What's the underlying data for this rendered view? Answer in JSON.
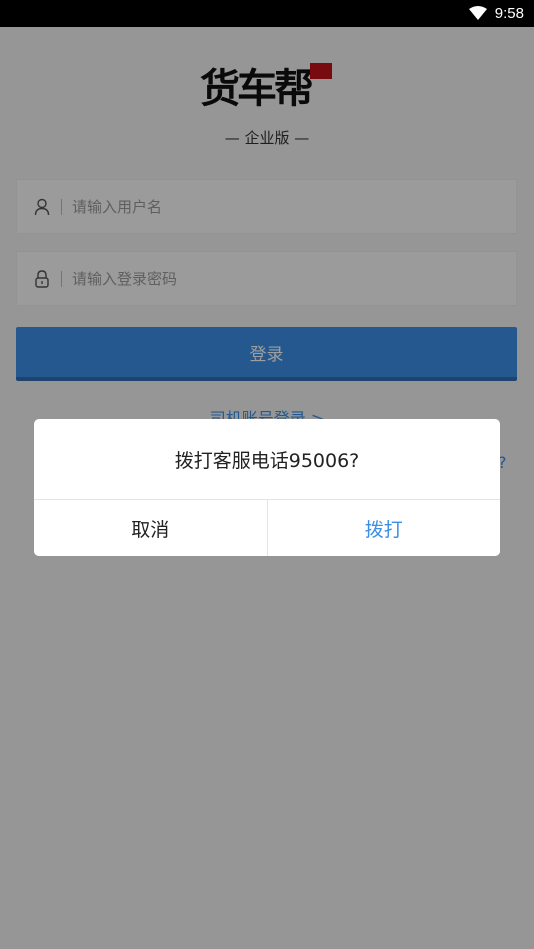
{
  "status_bar": {
    "time": "9:58",
    "wifi_icon": "wifi-icon"
  },
  "app": {
    "logo_text": "货车帮",
    "edition": "— 企业版 —",
    "username_placeholder": "请输入用户名",
    "password_placeholder": "请输入登录密码",
    "login_label": "登录",
    "driver_link": "司机账号登录 >",
    "help_link": "?"
  },
  "dialog": {
    "message": "拨打客服电话95006?",
    "cancel_label": "取消",
    "confirm_label": "拨打"
  },
  "colors": {
    "accent": "#3b8fe5",
    "flag": "#c0121b",
    "overlay": "rgba(0,0,0,0.38)"
  }
}
